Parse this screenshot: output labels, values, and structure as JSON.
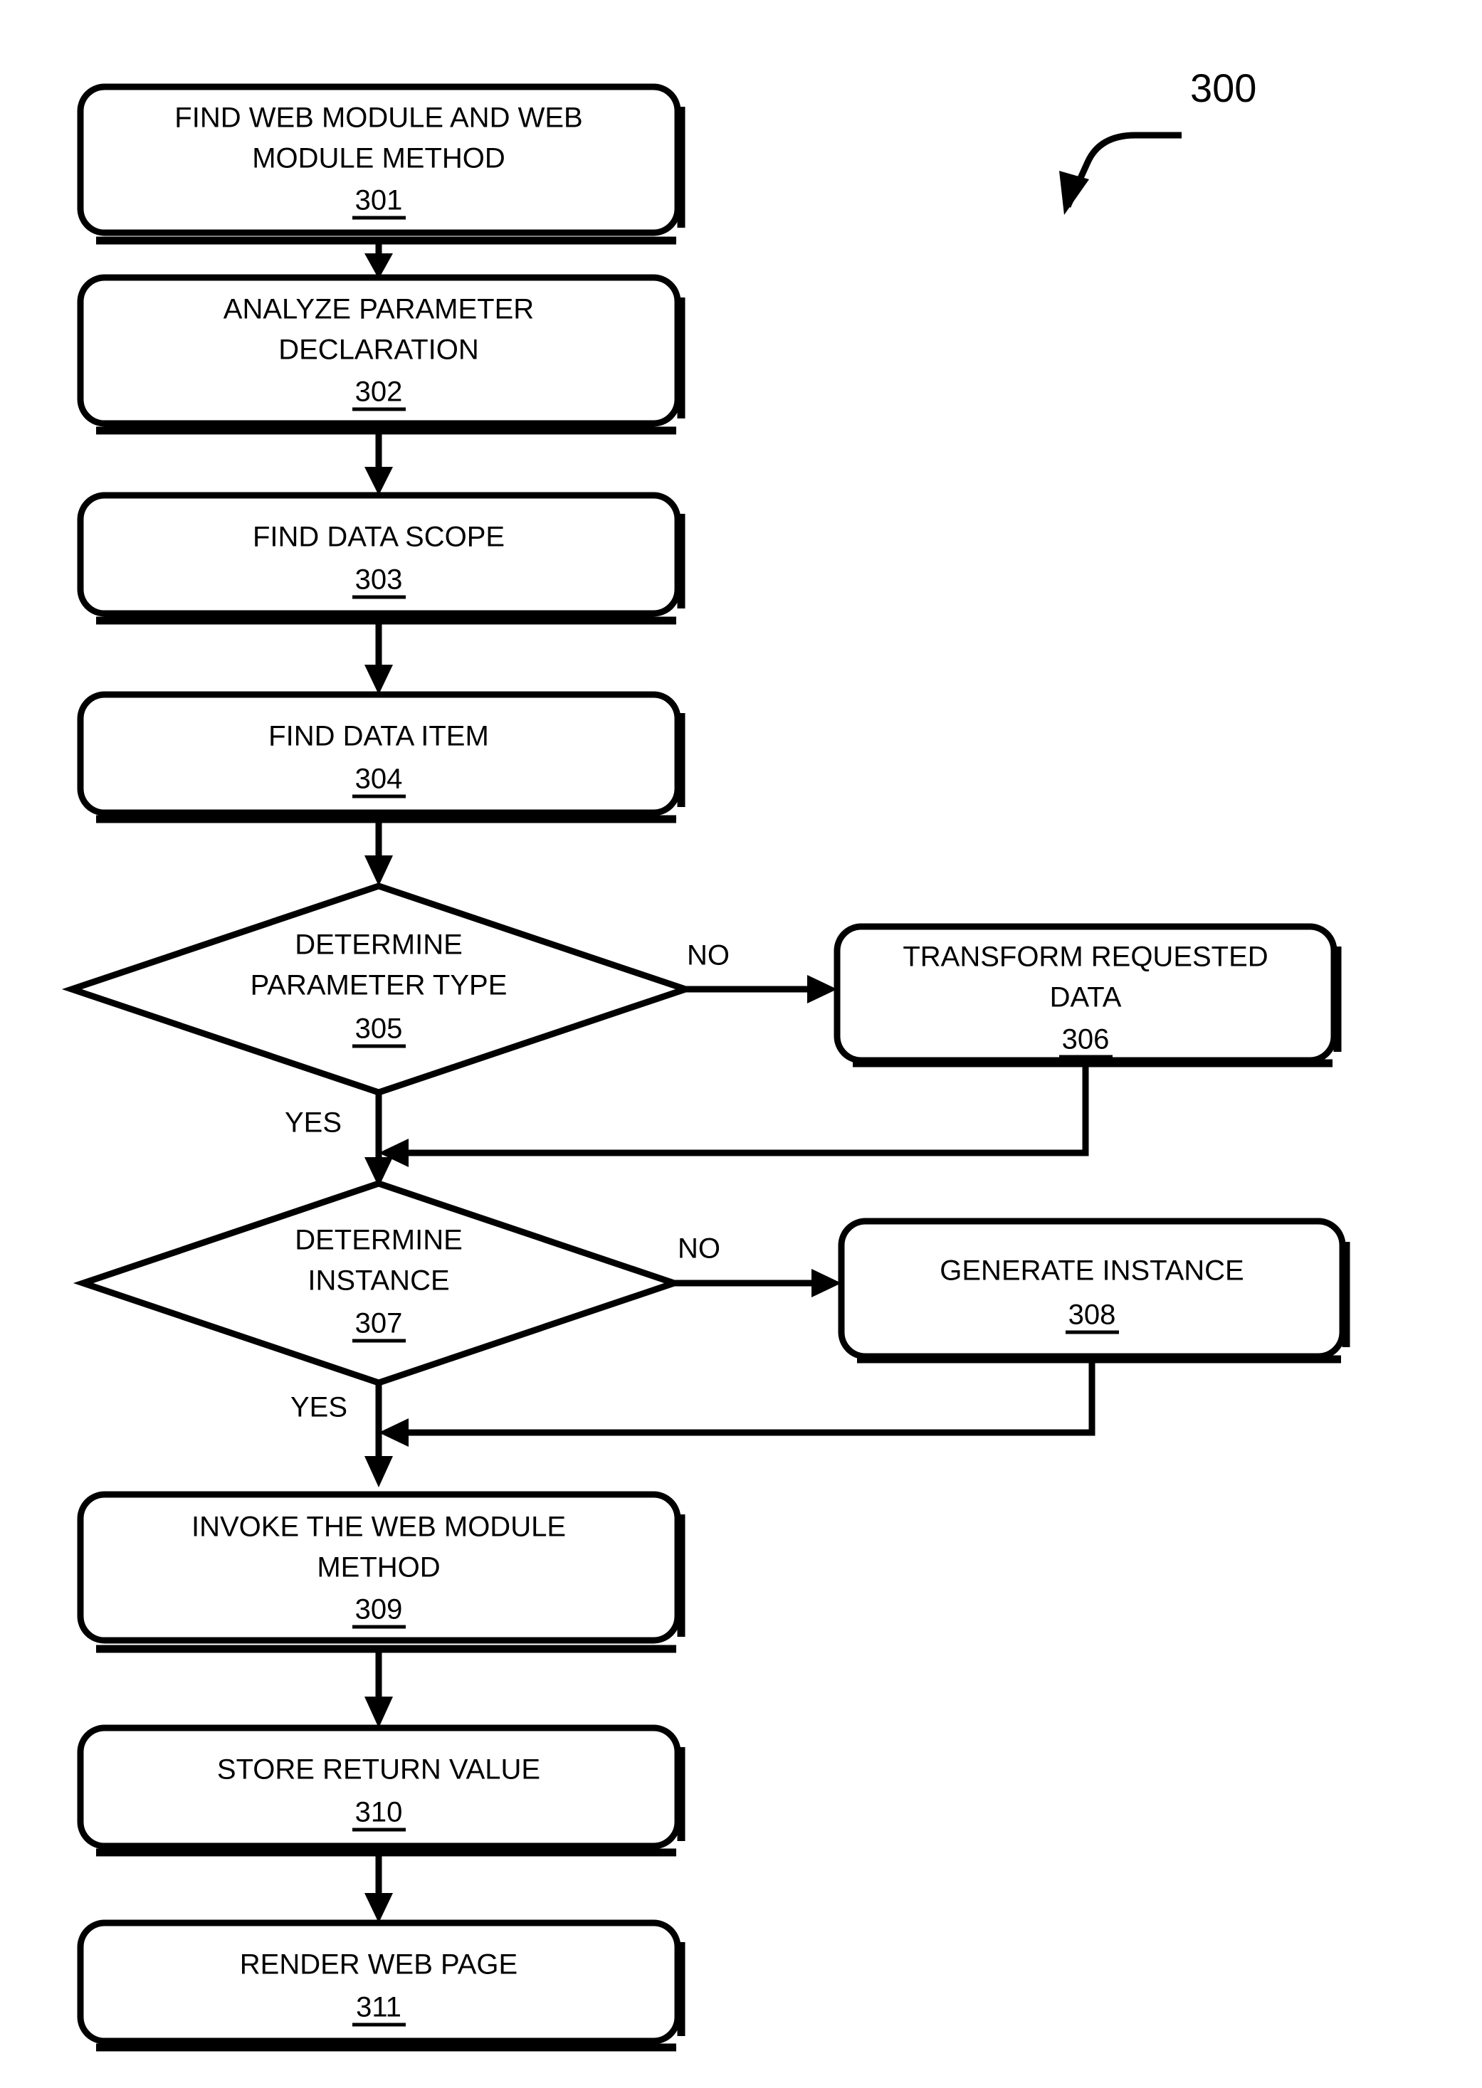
{
  "figure": {
    "label": "300",
    "pointer_icon": "curved-arrow-icon"
  },
  "diagram": {
    "type": "flowchart",
    "title": "",
    "nodes": [
      {
        "id": "n301",
        "shape": "rounded-rect",
        "lines": [
          "FIND WEB MODULE AND WEB",
          "MODULE METHOD"
        ],
        "ref": "301"
      },
      {
        "id": "n302",
        "shape": "rounded-rect",
        "lines": [
          "ANALYZE PARAMETER",
          "DECLARATION"
        ],
        "ref": "302"
      },
      {
        "id": "n303",
        "shape": "rounded-rect",
        "lines": [
          "FIND DATA SCOPE"
        ],
        "ref": "303"
      },
      {
        "id": "n304",
        "shape": "rounded-rect",
        "lines": [
          "FIND DATA ITEM"
        ],
        "ref": "304"
      },
      {
        "id": "n305",
        "shape": "diamond",
        "lines": [
          "DETERMINE",
          "PARAMETER TYPE"
        ],
        "ref": "305"
      },
      {
        "id": "n306",
        "shape": "rounded-rect",
        "lines": [
          "TRANSFORM REQUESTED",
          "DATA"
        ],
        "ref": "306"
      },
      {
        "id": "n307",
        "shape": "diamond",
        "lines": [
          "DETERMINE",
          "INSTANCE"
        ],
        "ref": "307"
      },
      {
        "id": "n308",
        "shape": "rounded-rect",
        "lines": [
          "GENERATE INSTANCE"
        ],
        "ref": "308"
      },
      {
        "id": "n309",
        "shape": "rounded-rect",
        "lines": [
          "INVOKE THE WEB MODULE",
          "METHOD"
        ],
        "ref": "309"
      },
      {
        "id": "n310",
        "shape": "rounded-rect",
        "lines": [
          "STORE RETURN VALUE"
        ],
        "ref": "310"
      },
      {
        "id": "n311",
        "shape": "rounded-rect",
        "lines": [
          "RENDER WEB PAGE"
        ],
        "ref": "311"
      }
    ],
    "branch_labels": {
      "no_305": "NO",
      "yes_305": "YES",
      "no_307": "NO",
      "yes_307": "YES"
    },
    "colors": {
      "stroke": "#000000",
      "fill": "#ffffff",
      "text": "#000000"
    }
  },
  "n301": {
    "line1": "FIND WEB MODULE AND WEB",
    "line2": "MODULE METHOD",
    "ref": "301"
  },
  "n302": {
    "line1": "ANALYZE PARAMETER",
    "line2": "DECLARATION",
    "ref": "302"
  },
  "n303": {
    "line1": "FIND DATA SCOPE",
    "ref": "303"
  },
  "n304": {
    "line1": "FIND DATA ITEM",
    "ref": "304"
  },
  "n305": {
    "line1": "DETERMINE",
    "line2": "PARAMETER TYPE",
    "ref": "305"
  },
  "n306": {
    "line1": "TRANSFORM REQUESTED",
    "line2": "DATA",
    "ref": "306"
  },
  "n307": {
    "line1": "DETERMINE",
    "line2": "INSTANCE",
    "ref": "307"
  },
  "n308": {
    "line1": "GENERATE INSTANCE",
    "ref": "308"
  },
  "n309": {
    "line1": "INVOKE THE WEB MODULE",
    "line2": "METHOD",
    "ref": "309"
  },
  "n310": {
    "line1": "STORE RETURN VALUE",
    "ref": "310"
  },
  "n311": {
    "line1": "RENDER WEB PAGE",
    "ref": "311"
  },
  "labels": {
    "no_305": "NO",
    "yes_305": "YES",
    "no_307": "NO",
    "yes_307": "YES"
  }
}
